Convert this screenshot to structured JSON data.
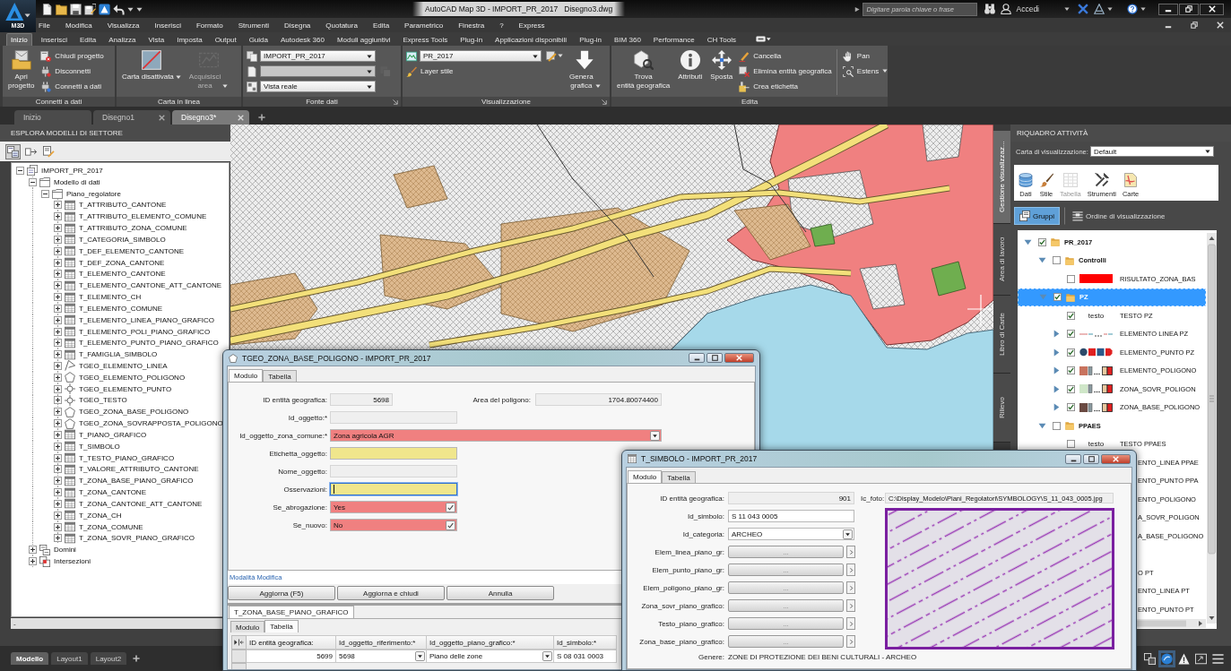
{
  "title_bar": {
    "app_button": "M3D",
    "title": "AutoCAD Map 3D - IMPORT_PR_2017   Disegno3.dwg",
    "search": {
      "placeholder": "Digitare parola chiave o frase"
    },
    "account": "Accedi"
  },
  "menu": [
    "File",
    "Modifica",
    "Visualizza",
    "Inserisci",
    "Formato",
    "Strumenti",
    "Disegna",
    "Quotatura",
    "Edita",
    "Parametrico",
    "Finestra",
    "?",
    "Express"
  ],
  "ribbon_tabs": [
    {
      "label": "Inizio",
      "selected": true
    },
    {
      "label": "Inserisci",
      "selected": false
    },
    {
      "label": "Edita",
      "selected": false
    },
    {
      "label": "Analizza",
      "selected": false
    },
    {
      "label": "Vista",
      "selected": false
    },
    {
      "label": "Imposta",
      "selected": false
    },
    {
      "label": "Output",
      "selected": false
    },
    {
      "label": "Guida",
      "selected": false
    },
    {
      "label": "Autodesk 360",
      "selected": false
    },
    {
      "label": "Moduli aggiuntivi",
      "selected": false
    },
    {
      "label": "Express Tools",
      "selected": false
    },
    {
      "label": "Plug-in",
      "selected": false
    },
    {
      "label": "Applicazioni disponibili",
      "selected": false
    },
    {
      "label": "Plug-in",
      "selected": false
    },
    {
      "label": "BIM 360",
      "selected": false
    },
    {
      "label": "Performance",
      "selected": false
    },
    {
      "label": "CH Tools",
      "selected": false
    }
  ],
  "ribbon_groups": [
    {
      "label": "Connetti a dati",
      "launcher": false,
      "items": [
        {
          "kind": "large",
          "label": "Apri\nprogetto",
          "menu": false,
          "disabled": false
        },
        {
          "kind": "stack",
          "items": [
            {
              "kind": "small",
              "label": "Chiudi progetto",
              "menu": false
            },
            {
              "kind": "small",
              "label": "Disconnetti",
              "menu": false
            },
            {
              "kind": "small",
              "label": "Connetti a dati",
              "menu": false
            }
          ]
        }
      ]
    },
    {
      "label": "Carta in linea",
      "launcher": false,
      "items": [
        {
          "kind": "large",
          "label": "Carta disattivata",
          "menu": true,
          "disabled": false
        },
        {
          "kind": "large",
          "label": "Acquisisci\narea",
          "menu": true,
          "disabled": true
        }
      ]
    },
    {
      "label": "Fonte dati",
      "launcher": true,
      "items": [
        {
          "kind": "stack",
          "items": [
            {
              "kind": "combo",
              "value": "IMPORT_PR_2017",
              "disabled": false
            },
            {
              "kind": "combo",
              "disabled": true,
              "button": {
                "disabled": true,
                "menu": false
              }
            },
            {
              "kind": "combo",
              "value": "Vista reale",
              "disabled": false
            }
          ]
        }
      ]
    },
    {
      "label": "Visualizzazione",
      "launcher": true,
      "items": [
        {
          "kind": "stack",
          "items": [
            {
              "kind": "combo",
              "value": "PR_2017",
              "disabled": false,
              "button": {
                "disabled": false,
                "menu": true
              }
            },
            {
              "kind": "small",
              "label": "Layer stile",
              "menu": false
            }
          ]
        },
        {
          "kind": "large",
          "label": "Genera\ngrafica",
          "menu": true,
          "disabled": false
        }
      ]
    },
    {
      "label": "Edita",
      "launcher": false,
      "items": [
        {
          "kind": "large",
          "label": "Trova\nentità geografica",
          "menu": false,
          "disabled": false
        },
        {
          "kind": "large",
          "label": "Attributi",
          "menu": false,
          "disabled": false
        },
        {
          "kind": "large",
          "label": "Sposta",
          "menu": false,
          "disabled": false
        },
        {
          "kind": "stack",
          "items": [
            {
              "kind": "small",
              "label": "Cancella",
              "menu": false
            },
            {
              "kind": "small",
              "label": "Elimina entità geografica",
              "menu": false
            },
            {
              "kind": "small",
              "label": "Crea etichetta",
              "menu": false
            }
          ]
        },
        {
          "kind": "stack",
          "items": [
            {
              "kind": "small",
              "label": "Pan",
              "menu": false
            },
            {
              "kind": "small",
              "label": "Estens",
              "menu": true
            }
          ]
        }
      ]
    }
  ],
  "document_tabs": [
    {
      "label": "Inizio",
      "selected": false,
      "closable": false
    },
    {
      "label": "Disegno1",
      "selected": false,
      "closable": true
    },
    {
      "label": "Disegno3*",
      "selected": true,
      "closable": true
    }
  ],
  "sector_explorer": {
    "title": "ESPLORA MODELLI DI SETTORE",
    "toolbar": [
      {
        "selected": true
      },
      {
        "selected": false
      },
      {
        "selected": false
      }
    ],
    "tree": [
      {
        "label": "IMPORT_PR_2017",
        "kind": "connection",
        "expanded": true,
        "children": [
          {
            "label": "Modello di dati",
            "kind": "folder",
            "expanded": true,
            "children": [
              {
                "label": "Piano_regolatore",
                "kind": "folder",
                "expanded": true,
                "children": [
                  {
                    "label": "T_ATTRIBUTO_CANTONE",
                    "kind": "table",
                    "expanded": false
                  },
                  {
                    "label": "T_ATTRIBUTO_ELEMENTO_COMUNE",
                    "kind": "table",
                    "expanded": false
                  },
                  {
                    "label": "T_ATTRIBUTO_ZONA_COMUNE",
                    "kind": "table",
                    "expanded": false
                  },
                  {
                    "label": "T_CATEGORIA_SIMBOLO",
                    "kind": "table",
                    "expanded": false
                  },
                  {
                    "label": "T_DEF_ELEMENTO_CANTONE",
                    "kind": "table",
                    "expanded": false
                  },
                  {
                    "label": "T_DEF_ZONA_CANTONE",
                    "kind": "table",
                    "expanded": false
                  },
                  {
                    "label": "T_ELEMENTO_CANTONE",
                    "kind": "table",
                    "expanded": false
                  },
                  {
                    "label": "T_ELEMENTO_CANTONE_ATT_CANTONE",
                    "kind": "table",
                    "expanded": false
                  },
                  {
                    "label": "T_ELEMENTO_CH",
                    "kind": "table",
                    "expanded": false
                  },
                  {
                    "label": "T_ELEMENTO_COMUNE",
                    "kind": "table",
                    "expanded": false
                  },
                  {
                    "label": "T_ELEMENTO_LINEA_PIANO_GRAFICO",
                    "kind": "table",
                    "expanded": false
                  },
                  {
                    "label": "T_ELEMENTO_POLI_PIANO_GRAFICO",
                    "kind": "table",
                    "expanded": false
                  },
                  {
                    "label": "T_ELEMENTO_PUNTO_PIANO_GRAFICO",
                    "kind": "table",
                    "expanded": false
                  },
                  {
                    "label": "T_FAMIGLIA_SIMBOLO",
                    "kind": "table",
                    "expanded": false
                  },
                  {
                    "label": "TGEO_ELEMENTO_LINEA",
                    "kind": "line",
                    "expanded": false
                  },
                  {
                    "label": "TGEO_ELEMENTO_POLIGONO",
                    "kind": "polygon",
                    "expanded": false
                  },
                  {
                    "label": "TGEO_ELEMENTO_PUNTO",
                    "kind": "point",
                    "expanded": false
                  },
                  {
                    "label": "TGEO_TESTO",
                    "kind": "point",
                    "expanded": false
                  },
                  {
                    "label": "TGEO_ZONA_BASE_POLIGONO",
                    "kind": "polygon",
                    "expanded": false
                  },
                  {
                    "label": "TGEO_ZONA_SOVRAPPOSTA_POLIGONO",
                    "kind": "polygon",
                    "expanded": false
                  },
                  {
                    "label": "T_PIANO_GRAFICO",
                    "kind": "table",
                    "expanded": false
                  },
                  {
                    "label": "T_SIMBOLO",
                    "kind": "table",
                    "expanded": false
                  },
                  {
                    "label": "T_TESTO_PIANO_GRAFICO",
                    "kind": "table",
                    "expanded": false
                  },
                  {
                    "label": "T_VALORE_ATTRIBUTO_CANTONE",
                    "kind": "table",
                    "expanded": false
                  },
                  {
                    "label": "T_ZONA_BASE_PIANO_GRAFICO",
                    "kind": "table",
                    "expanded": false
                  },
                  {
                    "label": "T_ZONA_CANTONE",
                    "kind": "table",
                    "expanded": false
                  },
                  {
                    "label": "T_ZONA_CANTONE_ATT_CANTONE",
                    "kind": "table",
                    "expanded": false
                  },
                  {
                    "label": "T_ZONA_CH",
                    "kind": "table",
                    "expanded": false
                  },
                  {
                    "label": "T_ZONA_COMUNE",
                    "kind": "table",
                    "expanded": false
                  },
                  {
                    "label": "T_ZONA_SOVR_PIANO_GRAFICO",
                    "kind": "table",
                    "expanded": false
                  }
                ]
              }
            ]
          },
          {
            "label": "Domini",
            "kind": "domains",
            "expanded": false
          },
          {
            "label": "Intersezioni",
            "kind": "intersections",
            "expanded": false
          }
        ]
      }
    ],
    "status": "-"
  },
  "task_pane": {
    "title": "RIQUADRO ATTIVITÀ",
    "side_tabs": [
      {
        "label": "Gestione visualizzaz...",
        "selected": true
      },
      {
        "label": "Area di lavoro",
        "selected": false
      },
      {
        "label": "Libro di Carte",
        "selected": false
      },
      {
        "label": "Rilievo",
        "selected": false
      }
    ],
    "map_selector": {
      "label": "Carta di visualizzazione:",
      "value": "Default"
    },
    "tools": [
      {
        "label": "Dati",
        "disabled": false
      },
      {
        "label": "Stile",
        "disabled": false
      },
      {
        "label": "Tabella",
        "disabled": true
      },
      {
        "label": "Strumenti",
        "disabled": false
      },
      {
        "label": "Carte",
        "disabled": false
      }
    ],
    "views": [
      {
        "label": "Gruppi",
        "selected": true
      },
      {
        "label": "Ordine di visualizzazione",
        "selected": false
      }
    ],
    "layers": [
      {
        "label": "PR_2017",
        "kind": "group",
        "expanded": true,
        "checked": true,
        "selected": false,
        "children": [
          {
            "label": "Controlli",
            "kind": "group",
            "expanded": true,
            "checked": false,
            "selected": false,
            "children": [
              {
                "label": "RISULTATO_ZONA_BAS",
                "kind": "layer",
                "checked": false,
                "selected": false,
                "preview": {
                  "kind": "swatch",
                  "color": "#ff0000"
                }
              }
            ]
          },
          {
            "label": "PZ",
            "kind": "group",
            "expanded": true,
            "checked": true,
            "selected": true,
            "children": [
              {
                "label": "TESTO PZ",
                "kind": "layer",
                "checked": true,
                "selected": false,
                "preview": {
                  "kind": "text",
                  "text": "testo"
                }
              },
              {
                "label": "ELEMENTO LINEA PZ",
                "kind": "layer",
                "expanded": false,
                "checked": true,
                "selected": false,
                "preview": {
                  "kind": "line"
                }
              },
              {
                "label": "ELEMENTO_PUNTO PZ",
                "kind": "layer",
                "expanded": false,
                "checked": true,
                "selected": false,
                "preview": {
                  "kind": "points"
                }
              },
              {
                "label": "ELEMENTO_POLIGONO",
                "kind": "layer",
                "expanded": false,
                "checked": true,
                "selected": false,
                "preview": {
                  "kind": "polygons",
                  "color": "#c8735e"
                }
              },
              {
                "label": "ZONA_SOVR_POLIGON",
                "kind": "layer",
                "expanded": false,
                "checked": true,
                "selected": false,
                "preview": {
                  "kind": "polygons",
                  "color": "#cfe6c8"
                }
              },
              {
                "label": "ZONA_BASE_POLIGONO",
                "kind": "layer",
                "expanded": false,
                "checked": true,
                "selected": false,
                "preview": {
                  "kind": "polygons",
                  "color": "#6a4a42"
                }
              }
            ]
          },
          {
            "label": "PPAES",
            "kind": "group",
            "expanded": true,
            "checked": false,
            "selected": false,
            "children": [
              {
                "label": "TESTO PPAES",
                "kind": "layer",
                "checked": false,
                "selected": false,
                "preview": {
                  "kind": "text",
                  "text": "testo"
                }
              }
            ]
          }
        ]
      }
    ],
    "partly_covered_rows": [
      [
        "ENTO_LINEA PPAE",
        "ENTO_PUNTO PPA",
        "ENTO_POLIGONO",
        "A_SOVR_POLIGON",
        "A_BASE_POLIGONO"
      ],
      [
        "O PT",
        "ENTO_LINEA PT",
        "ENTO_PUNTO PT"
      ]
    ]
  },
  "layout_tabs": [
    {
      "label": "Modello",
      "selected": true
    },
    {
      "label": "Layout1",
      "selected": false
    },
    {
      "label": "Layout2",
      "selected": false
    }
  ],
  "feature_form": {
    "title": "TGEO_ZONA_BASE_POLIGONO - IMPORT_PR_2017",
    "tabs": [
      {
        "label": "Modulo",
        "selected": true
      },
      {
        "label": "Tabella",
        "selected": false
      }
    ],
    "fields": [
      {
        "label": "ID entità geografica:",
        "kind": "readonly",
        "value": "5698",
        "focused": false
      },
      {
        "label": "Id_oggetto:*",
        "kind": "readonly",
        "focused": false
      },
      {
        "label": "Id_oggetto_zona_comune:*",
        "kind": "dropdown",
        "value": "Zona agricola AGR",
        "color": "#f08080",
        "focused": false
      },
      {
        "label": "Etichetta_oggetto:",
        "kind": "text",
        "color": "#f0e68c",
        "focused": false
      },
      {
        "label": "Nome_oggetto:",
        "kind": "readonly",
        "focused": false
      },
      {
        "label": "Osservazioni:",
        "kind": "text",
        "color": "#f0e68c",
        "focused": true
      },
      {
        "label": "Se_abrogazione:",
        "kind": "check",
        "value": "Yes",
        "color": "#f08080",
        "focused": false
      },
      {
        "label": "Se_nuovo:",
        "kind": "check",
        "value": "No",
        "color": "#f08080",
        "focused": false
      }
    ],
    "area_field": {
      "label": "Area del poligono:",
      "value": "1704.80074400"
    },
    "mode": "Modalità Modifica",
    "buttons": [
      "Aggiorna (F5)",
      "Aggiorna e chiudi",
      "Annulla"
    ],
    "related_table": {
      "title": "T_ZONA_BASE_PIANO_GRAFICO",
      "tabs": [
        {
          "label": "Modulo",
          "selected": false
        },
        {
          "label": "Tabella",
          "selected": true
        }
      ],
      "columns": [
        {
          "label": "ID entità geografica:",
          "kind": "number"
        },
        {
          "label": "Id_oggetto_riferimento:*",
          "kind": "dropdown"
        },
        {
          "label": "Id_oggetto_piano_grafico:*",
          "kind": "dropdown"
        },
        {
          "label": "Id_simbolo:*",
          "kind": "text"
        }
      ],
      "rows": [
        [
          "5699",
          "5698",
          "Piano delle zone",
          "S 08 031 0003"
        ]
      ]
    }
  },
  "symbol_form": {
    "title": "T_SIMBOLO - IMPORT_PR_2017",
    "tabs": [
      {
        "label": "Modulo",
        "selected": true
      },
      {
        "label": "Tabella",
        "selected": false
      }
    ],
    "fields": [
      {
        "label": "ID entità geografica:",
        "kind": "readonly",
        "value": "901"
      },
      {
        "label": "Id_simbolo:",
        "kind": "text",
        "value": "S 11 043 0005"
      },
      {
        "label": "Id_categoria:",
        "kind": "dropdown",
        "value": "ARCHEO"
      },
      {
        "label": "Elem_linea_piano_gr:",
        "kind": "link",
        "value": "..."
      },
      {
        "label": "Elem_punto_piano_gr:",
        "kind": "link",
        "value": "..."
      },
      {
        "label": "Elem_poligono_piano_gr:",
        "kind": "link",
        "value": "..."
      },
      {
        "label": "Zona_sovr_piano_grafico:",
        "kind": "link",
        "value": "..."
      },
      {
        "label": "Testo_piano_grafico:",
        "kind": "link",
        "value": "..."
      },
      {
        "label": "Zona_base_piano_grafico:",
        "kind": "link",
        "value": "..."
      }
    ],
    "photo": {
      "label": "Ic_foto:",
      "path": "C:\\Display_Modelo\\Piani_Regolatori\\SYMBOLOGY\\S_11_043_0005.jpg"
    },
    "genre": {
      "label": "Genere:",
      "value": "ZONE DI PROTEZIONE DEI BENI CULTURALI - ARCHEO"
    }
  }
}
